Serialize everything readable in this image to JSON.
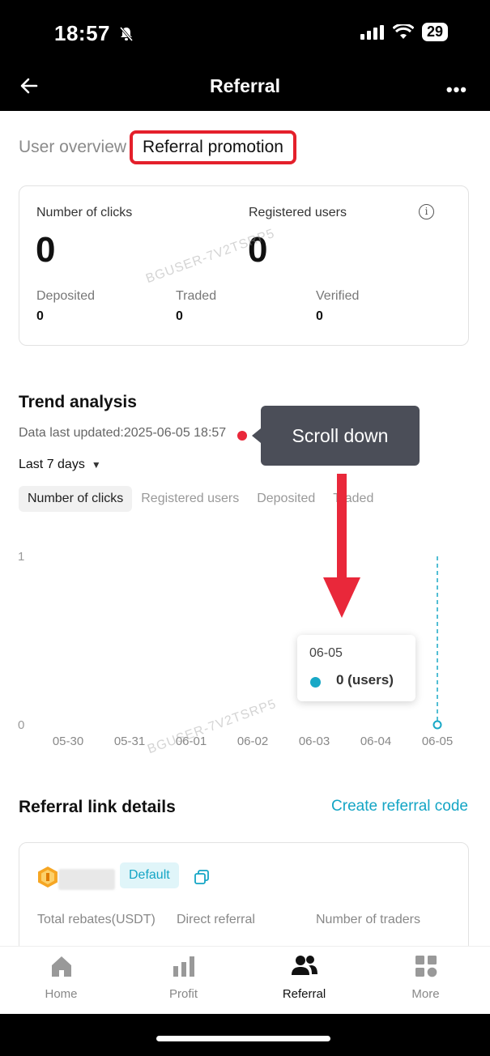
{
  "status": {
    "time": "18:57",
    "battery": "29"
  },
  "nav": {
    "title": "Referral"
  },
  "tabs": {
    "overview": "User overview",
    "promotion": "Referral promotion"
  },
  "stats": {
    "clicks_label": "Number of clicks",
    "clicks_value": "0",
    "registered_label": "Registered users",
    "registered_value": "0",
    "deposited_label": "Deposited",
    "deposited_value": "0",
    "traded_label": "Traded",
    "traded_value": "0",
    "verified_label": "Verified",
    "verified_value": "0"
  },
  "watermark": "BGUSER-7V2TSRP5",
  "trend": {
    "title": "Trend analysis",
    "updated": "Data last updated:2025-06-05 18:57",
    "range": "Last 7 days",
    "metric_tabs": [
      "Number of clicks",
      "Registered users",
      "Deposited",
      "Traded"
    ]
  },
  "chart_data": {
    "type": "line",
    "x": [
      "05-30",
      "05-31",
      "06-01",
      "06-02",
      "06-03",
      "06-04",
      "06-05"
    ],
    "series": [
      {
        "values": [
          0,
          0,
          0,
          0,
          0,
          0,
          0
        ]
      }
    ],
    "ylim": [
      0,
      1
    ],
    "yticks": [
      "0",
      "1"
    ],
    "selected_point": {
      "x": "06-05",
      "value": "0 (users)"
    }
  },
  "tooltip": {
    "text": "Scroll down"
  },
  "referral": {
    "title": "Referral link details",
    "create": "Create referral code",
    "badge": "Default",
    "col1": "Total rebates(USDT)",
    "col2": "Direct referral",
    "col3": "Number of traders"
  },
  "bottom_nav": [
    {
      "label": "Home",
      "icon": "home-icon"
    },
    {
      "label": "Profit",
      "icon": "bar-chart-icon"
    },
    {
      "label": "Referral",
      "icon": "users-icon"
    },
    {
      "label": "More",
      "icon": "grid-icon"
    }
  ],
  "colors": {
    "accent": "#14a5c5",
    "highlight": "#e4202b",
    "tooltip_bg": "#4b4e58"
  }
}
